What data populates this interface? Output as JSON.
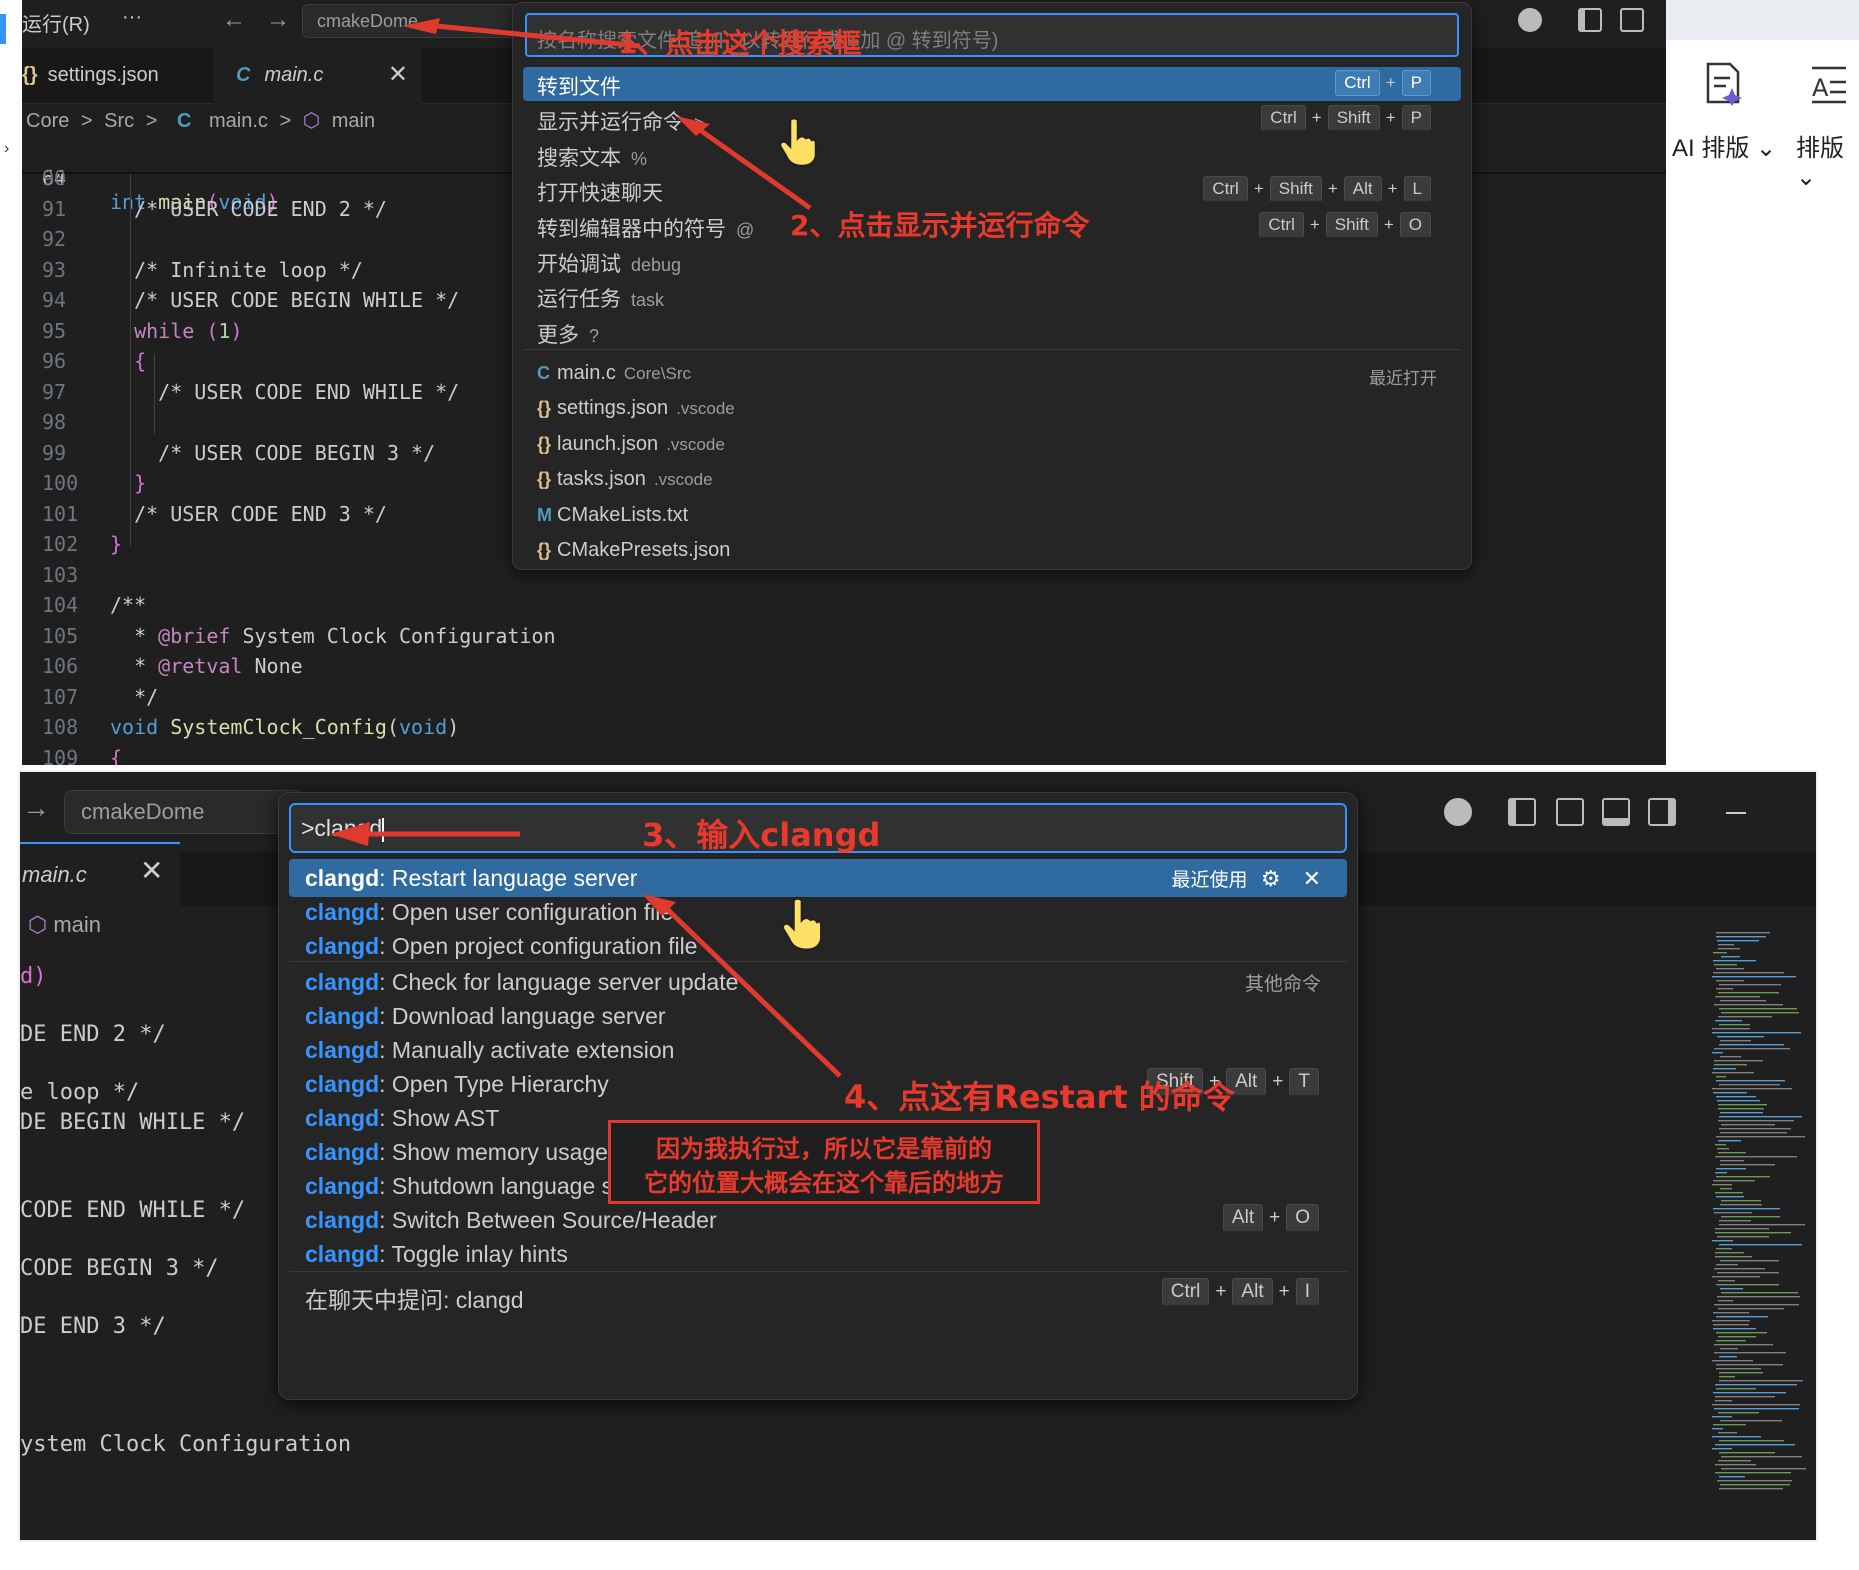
{
  "top": {
    "menu_run": "运行(R)",
    "menu_more": "···",
    "title_search": "cmakeDome",
    "tabs": [
      {
        "icon": "{}",
        "label": "settings.json"
      },
      {
        "icon": "C",
        "label": "main.c",
        "close": "✕"
      }
    ],
    "breadcrumb": [
      "Core",
      ">",
      "Src",
      ">",
      "C",
      "main.c",
      ">",
      "⬡",
      "main"
    ],
    "sticky": {
      "line": "64",
      "text": "int main(void)"
    },
    "code_lines": [
      {
        "n": "90",
        "t": ""
      },
      {
        "n": "91",
        "t": "  /* USER CODE END 2 */"
      },
      {
        "n": "92",
        "t": ""
      },
      {
        "n": "93",
        "t": "  /* Infinite loop */"
      },
      {
        "n": "94",
        "t": "  /* USER CODE BEGIN WHILE */"
      },
      {
        "n": "95",
        "t": "  while (1)"
      },
      {
        "n": "96",
        "t": "  {"
      },
      {
        "n": "97",
        "t": "    /* USER CODE END WHILE */"
      },
      {
        "n": "98",
        "t": ""
      },
      {
        "n": "99",
        "t": "    /* USER CODE BEGIN 3 */"
      },
      {
        "n": "100",
        "t": "  }"
      },
      {
        "n": "101",
        "t": "  /* USER CODE END 3 */"
      },
      {
        "n": "102",
        "t": "}"
      },
      {
        "n": "103",
        "t": ""
      },
      {
        "n": "104",
        "t": "/**"
      },
      {
        "n": "105",
        "t": "  * @brief System Clock Configuration"
      },
      {
        "n": "106",
        "t": "  * @retval None"
      },
      {
        "n": "107",
        "t": "  */"
      },
      {
        "n": "108",
        "t": "void SystemClock_Config(void)"
      },
      {
        "n": "109",
        "t": "{"
      }
    ],
    "quickpick": {
      "placeholder": "按名称搜索文件(追加 : 以转到行或追加 @ 转到符号)",
      "commands": [
        {
          "label": "转到文件",
          "hint": "",
          "keys": [
            "Ctrl",
            "P"
          ],
          "selected": true
        },
        {
          "label": "显示并运行命令",
          "hint": ">",
          "keys": [
            "Ctrl",
            "Shift",
            "P"
          ]
        },
        {
          "label": "搜索文本",
          "hint": "%",
          "keys": []
        },
        {
          "label": "打开快速聊天",
          "hint": "",
          "keys": [
            "Ctrl",
            "Shift",
            "Alt",
            "L"
          ]
        },
        {
          "label": "转到编辑器中的符号",
          "hint": "@",
          "keys": [
            "Ctrl",
            "Shift",
            "O"
          ]
        },
        {
          "label": "开始调试",
          "hint": "debug",
          "keys": []
        },
        {
          "label": "运行任务",
          "hint": "task",
          "keys": []
        },
        {
          "label": "更多",
          "hint": "?",
          "keys": []
        }
      ],
      "recent_label": "最近打开",
      "files": [
        {
          "icon": "C",
          "name": "main.c",
          "path": "Core\\Src",
          "color": "#519aba"
        },
        {
          "icon": "{}",
          "name": "settings.json",
          "path": ".vscode",
          "color": "#e2c08d"
        },
        {
          "icon": "{}",
          "name": "launch.json",
          "path": ".vscode",
          "color": "#e2c08d"
        },
        {
          "icon": "{}",
          "name": "tasks.json",
          "path": ".vscode",
          "color": "#e2c08d"
        },
        {
          "icon": "M",
          "name": "CMakeLists.txt",
          "path": "",
          "color": "#519aba"
        },
        {
          "icon": "{}",
          "name": "CMakePresets.json",
          "path": "",
          "color": "#e2c08d"
        }
      ]
    },
    "ribbon": {
      "ai_layout": "AI 排版",
      "layout": "排版"
    },
    "annotations": {
      "step1": "1、点击这个搜索框",
      "step2": "2、点击显示并运行命令"
    }
  },
  "bottom": {
    "title_search": "cmakeDome",
    "tab_label": "main.c",
    "tab_close": "✕",
    "breadcrumb": "main",
    "code_fragments": [
      "d)",
      "DE END 2 */",
      "e loop */",
      "DE BEGIN WHILE */",
      "CODE END WHILE */",
      "CODE BEGIN 3 */",
      "DE END 3 */",
      "ystem Clock Configuration"
    ],
    "quickpick": {
      "input": ">clangd",
      "recent_label": "最近使用",
      "other_label": "其他命令",
      "prefix": "clangd",
      "commands": [
        {
          "label": ": Restart language server",
          "selected": true,
          "keys": []
        },
        {
          "label": ": Open user configuration file",
          "keys": []
        },
        {
          "label": ": Open project configuration file",
          "keys": []
        },
        {
          "label": ": Check for language server update",
          "keys": []
        },
        {
          "label": ": Download language server",
          "keys": []
        },
        {
          "label": ": Manually activate extension",
          "keys": []
        },
        {
          "label": ": Open Type Hierarchy",
          "keys": [
            "Shift",
            "Alt",
            "T"
          ]
        },
        {
          "label": ": Show AST",
          "keys": []
        },
        {
          "label": ": Show memory usage",
          "keys": []
        },
        {
          "label": ": Shutdown language server",
          "keys": []
        },
        {
          "label": ": Switch Between Source/Header",
          "keys": [
            "Alt",
            "O"
          ]
        },
        {
          "label": ": Toggle inlay hints",
          "keys": []
        }
      ],
      "chat": {
        "label": "在聊天中提问: clangd",
        "keys": [
          "Ctrl",
          "Alt",
          "I"
        ]
      }
    },
    "annotations": {
      "step3": "3、输入clangd",
      "step4": "4、点这有Restart 的命令",
      "note_line1": "因为我执行过，所以它是靠前的",
      "note_line2": "它的位置大概会在这个靠后的地方"
    }
  },
  "colors": {
    "accent": "#3794ff",
    "selection": "#2f6aa0",
    "annotation": "#e8392d",
    "editor_bg": "#1f1f1f"
  }
}
